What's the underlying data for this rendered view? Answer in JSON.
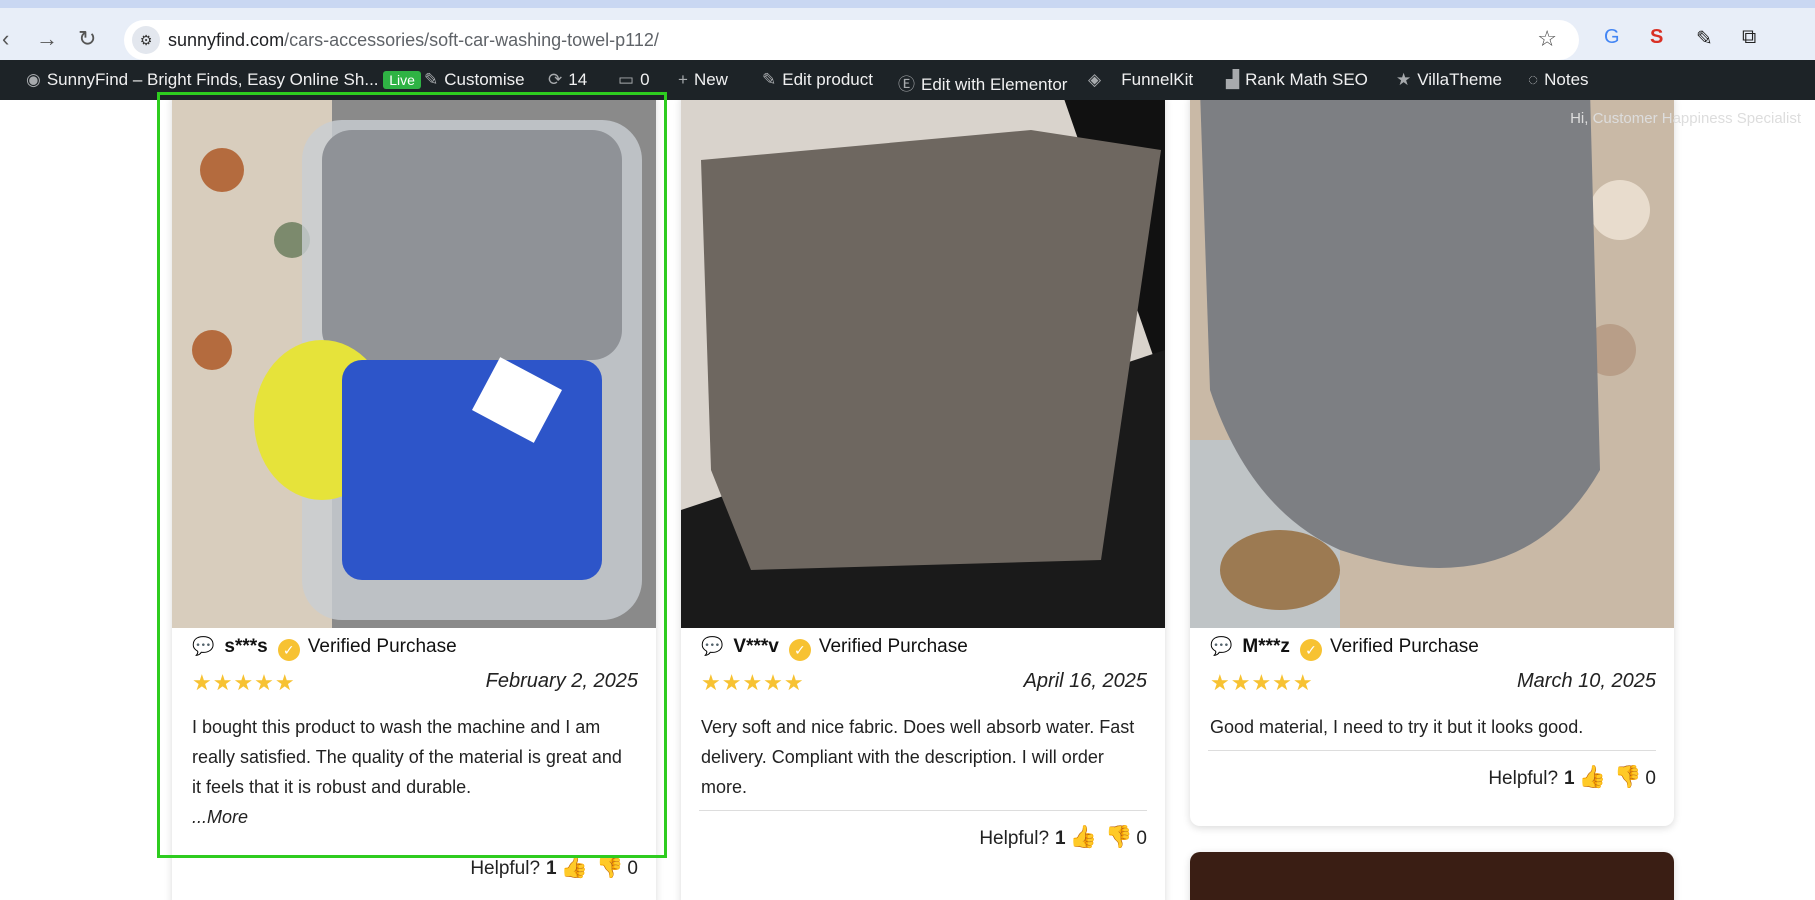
{
  "browser": {
    "url_domain": "sunnyfind.com",
    "url_path": "/cars-accessories/soft-car-washing-towel-p112/"
  },
  "admin_bar": {
    "site_name": "SunnyFind – Bright Finds, Easy Online Sh...",
    "live_badge": "Live",
    "customise": "Customise",
    "updates_count": "14",
    "comments_count": "0",
    "new": "New",
    "edit_product": "Edit product",
    "edit_elementor": "Edit with Elementor",
    "funnelkit": "FunnelKit",
    "rank_math": "Rank Math SEO",
    "villatheme": "VillaTheme",
    "notes": "Notes",
    "greeting": "Hi, Customer Happiness Specialist"
  },
  "reviews": [
    {
      "name": "s***s",
      "verified": "Verified Purchase",
      "stars": "★★★★★",
      "date": "February 2, 2025",
      "text": "I bought this product to wash the machine and I am really satisfied. The quality of the material is great and it feels that it is robust and durable.",
      "more": "...More",
      "helpful_label": "Helpful?",
      "up": "1",
      "down": "0"
    },
    {
      "name": "V***v",
      "verified": "Verified Purchase",
      "stars": "★★★★★",
      "date": "April 16, 2025",
      "text": "Very soft and nice fabric. Does well absorb water. Fast delivery. Compliant with the description. I will order more.",
      "helpful_label": "Helpful?",
      "up": "1",
      "down": "0"
    },
    {
      "name": "M***z",
      "verified": "Verified Purchase",
      "stars": "★★★★★",
      "date": "March 10, 2025",
      "text": "Good material, I need to try it but it looks good.",
      "helpful_label": "Helpful?",
      "up": "1",
      "down": "0"
    }
  ]
}
